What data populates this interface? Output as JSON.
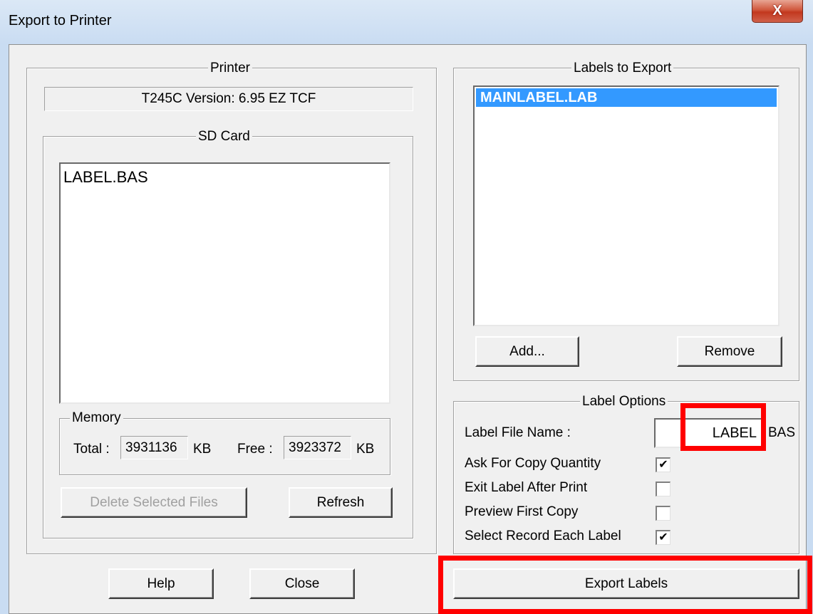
{
  "window": {
    "title": "Export to Printer",
    "close_glyph": "X"
  },
  "printer": {
    "group_label": "Printer",
    "version": "T245C Version: 6.95 EZ TCF"
  },
  "sd_card": {
    "group_label": "SD Card",
    "files": [
      "LABEL.BAS"
    ]
  },
  "memory": {
    "group_label": "Memory",
    "total_label": "Total :",
    "total_value": "3931136",
    "total_unit": "KB",
    "free_label": "Free :",
    "free_value": "3923372",
    "free_unit": "KB"
  },
  "buttons": {
    "delete_selected": "Delete Selected Files",
    "refresh": "Refresh",
    "add": "Add...",
    "remove": "Remove",
    "help": "Help",
    "close": "Close",
    "export_labels": "Export Labels"
  },
  "labels_to_export": {
    "group_label": "Labels to Export",
    "items": [
      "MAINLABEL.LAB"
    ],
    "selected_color": "#3399ff"
  },
  "label_options": {
    "group_label": "Label Options",
    "file_name_label": "Label File Name :",
    "file_name_value": "LABEL",
    "file_ext": "BAS",
    "ask_copy_quantity": {
      "label": "Ask For Copy Quantity",
      "checked": true
    },
    "exit_after_print": {
      "label": "Exit Label After Print",
      "checked": false
    },
    "preview_first_copy": {
      "label": "Preview First Copy",
      "checked": false
    },
    "select_record_each": {
      "label": "Select Record Each Label",
      "checked": true
    }
  },
  "colors": {
    "highlight": "#ff0000",
    "dialog_bg": "#f0f0f0"
  }
}
